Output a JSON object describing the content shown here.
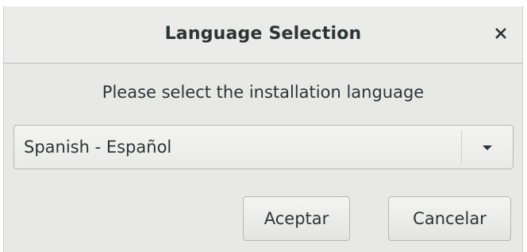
{
  "dialog": {
    "title": "Language Selection",
    "close_icon": "close-icon",
    "prompt": "Please select the installation language",
    "language_select": {
      "selected": "Spanish - Español",
      "arrow_icon": "chevron-down-icon"
    },
    "buttons": {
      "accept_label": "Aceptar",
      "cancel_label": "Cancelar"
    }
  }
}
